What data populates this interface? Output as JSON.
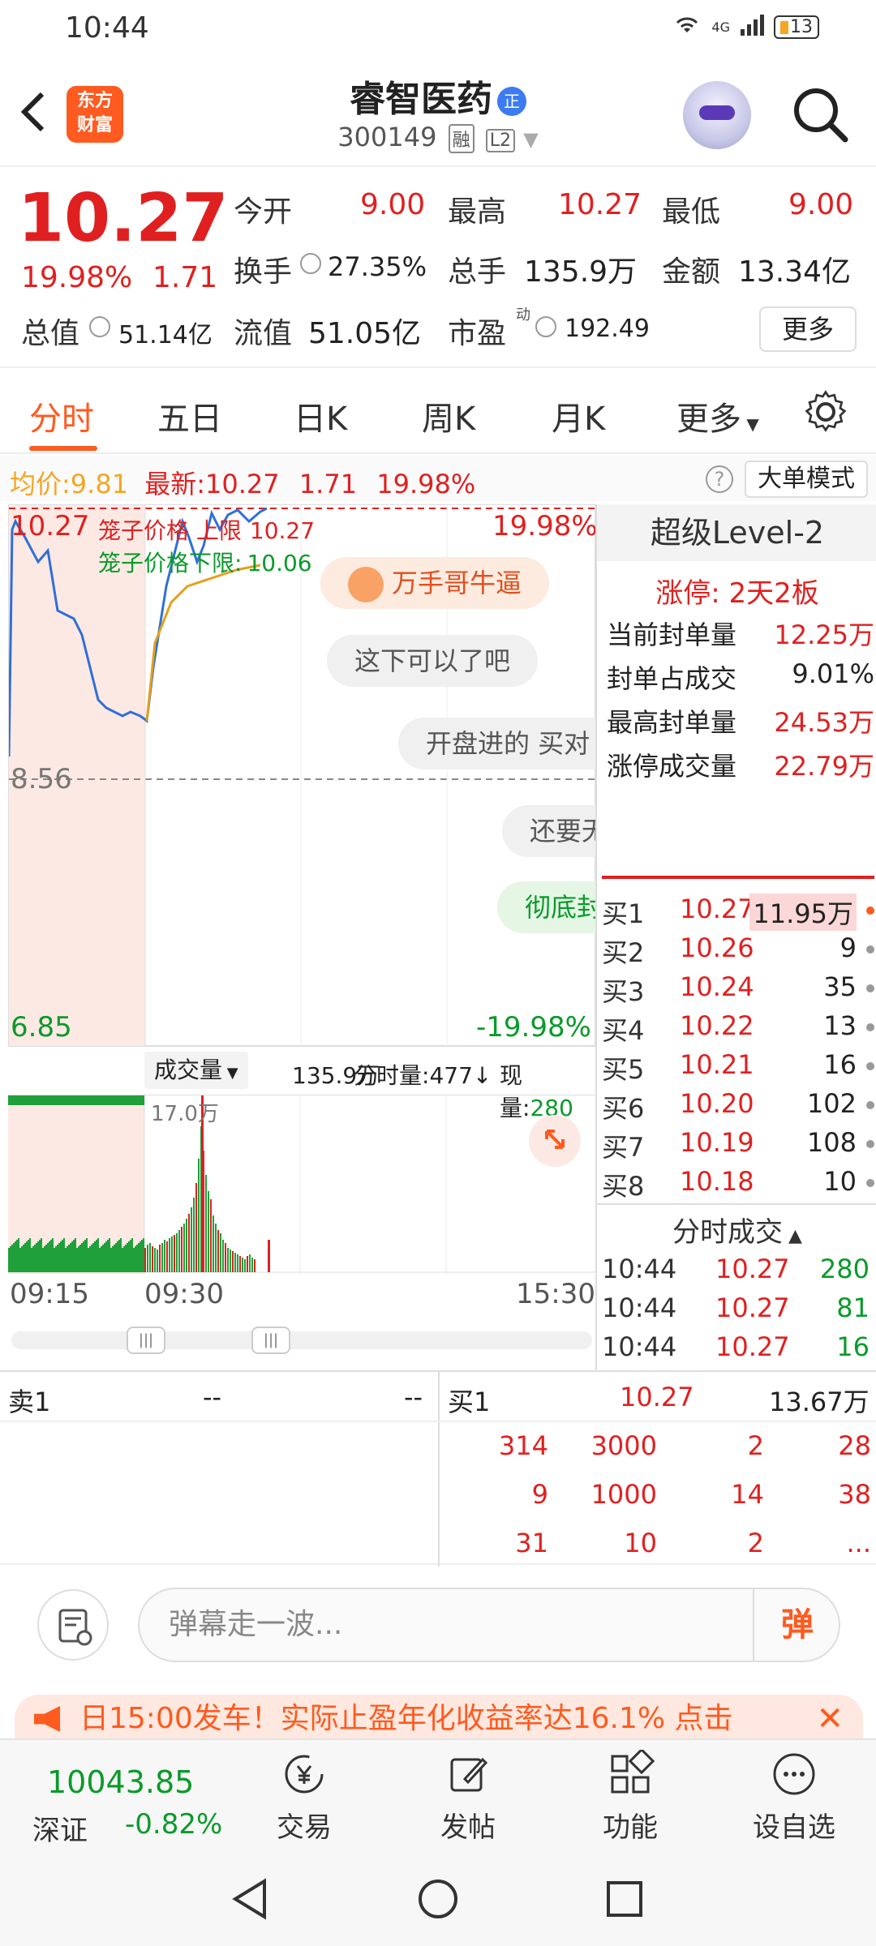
{
  "status": {
    "time": "10:44",
    "signal_label": "4G",
    "battery": "13"
  },
  "header": {
    "stock_name": "睿智医药",
    "name_badge": "正",
    "code": "300149",
    "tag_margin": "融",
    "tag_level": "L2",
    "logo_line1": "东方",
    "logo_line2": "财富"
  },
  "quote": {
    "price": "10.27",
    "pct": "19.98%",
    "change": "1.71",
    "open_label": "今开",
    "open": "9.00",
    "high_label": "最高",
    "high": "10.27",
    "low_label": "最低",
    "low": "9.00",
    "turnover_label": "换手",
    "turnover": "27.35%",
    "volume_label": "总手",
    "volume": "135.9万",
    "amount_label": "金额",
    "amount": "13.34亿",
    "mktcap_label": "总值",
    "mktcap": "51.14亿",
    "float_label": "流值",
    "float": "51.05亿",
    "pe_label": "市盈",
    "pe_sup": "动",
    "pe": "192.49",
    "more_label": "更多"
  },
  "tabs": [
    "分时",
    "五日",
    "日K",
    "周K",
    "月K",
    "更多"
  ],
  "avg": {
    "avg_label": "均价:",
    "avg": "9.81",
    "latest_label": "最新:",
    "latest": "10.27",
    "change": "1.71",
    "pct": "19.98%",
    "big_order_btn": "大单模式"
  },
  "chart": {
    "top_price": "10.27",
    "top_pct": "19.98%",
    "mid_price": "8.56",
    "bottom_price": "6.85",
    "bottom_pct": "-19.98%",
    "cage_upper_label": "笼子价格 上限",
    "cage_upper": "10.27",
    "cage_lower_label": "笼子价格下限:",
    "cage_lower": "10.06",
    "bubbles": [
      "万手哥牛逼",
      "这下可以了吧",
      "开盘进的 买对",
      "还要无",
      "彻底封"
    ]
  },
  "volume_bar": {
    "dropdown": "成交量",
    "total": "135.9万",
    "minute_label": "分时量:",
    "minute": "477",
    "arrow": "↓",
    "now_label": "现量:",
    "now": "280",
    "peak": "17.0万"
  },
  "time_axis": [
    "09:15",
    "09:30",
    "15:30"
  ],
  "l2": {
    "title": "超级Level-2",
    "limit_up": "涨停:  2天2板",
    "rows": [
      {
        "label": "当前封单量",
        "value": "12.25万"
      },
      {
        "label": "封单占成交",
        "value": "9.01%"
      },
      {
        "label": "最高封单量",
        "value": "24.53万"
      },
      {
        "label": "涨停成交量",
        "value": "22.79万"
      }
    ],
    "bids": [
      {
        "label": "买1",
        "price": "10.27",
        "qty": "11.95万"
      },
      {
        "label": "买2",
        "price": "10.26",
        "qty": "9"
      },
      {
        "label": "买3",
        "price": "10.24",
        "qty": "35"
      },
      {
        "label": "买4",
        "price": "10.22",
        "qty": "13"
      },
      {
        "label": "买5",
        "price": "10.21",
        "qty": "16"
      },
      {
        "label": "买6",
        "price": "10.20",
        "qty": "102"
      },
      {
        "label": "买7",
        "price": "10.19",
        "qty": "108"
      },
      {
        "label": "买8",
        "price": "10.18",
        "qty": "10"
      }
    ],
    "trades_title": "分时成交",
    "trades": [
      {
        "time": "10:44",
        "price": "10.27",
        "qty": "280"
      },
      {
        "time": "10:44",
        "price": "10.27",
        "qty": "81"
      },
      {
        "time": "10:44",
        "price": "10.27",
        "qty": "16"
      }
    ]
  },
  "book": {
    "sell_label": "卖1",
    "sell_price": "--",
    "sell_qty": "--",
    "buy_label": "买1",
    "buy_price": "10.27",
    "buy_qty": "13.67万",
    "queue": [
      [
        "314",
        "3000",
        "2",
        "28"
      ],
      [
        "9",
        "1000",
        "14",
        "38"
      ],
      [
        "31",
        "10",
        "2",
        "..."
      ]
    ]
  },
  "danmu": {
    "placeholder": "弹幕走一波...",
    "send": "弹"
  },
  "ad": {
    "text": "日15:00发车！实际止盈年化收益率达16.1%   点击"
  },
  "bottom_nav": {
    "index_value": "10043.85",
    "index_name": "深证",
    "index_change": "-0.82%",
    "items": [
      "交易",
      "发帖",
      "功能",
      "设自选"
    ]
  }
}
